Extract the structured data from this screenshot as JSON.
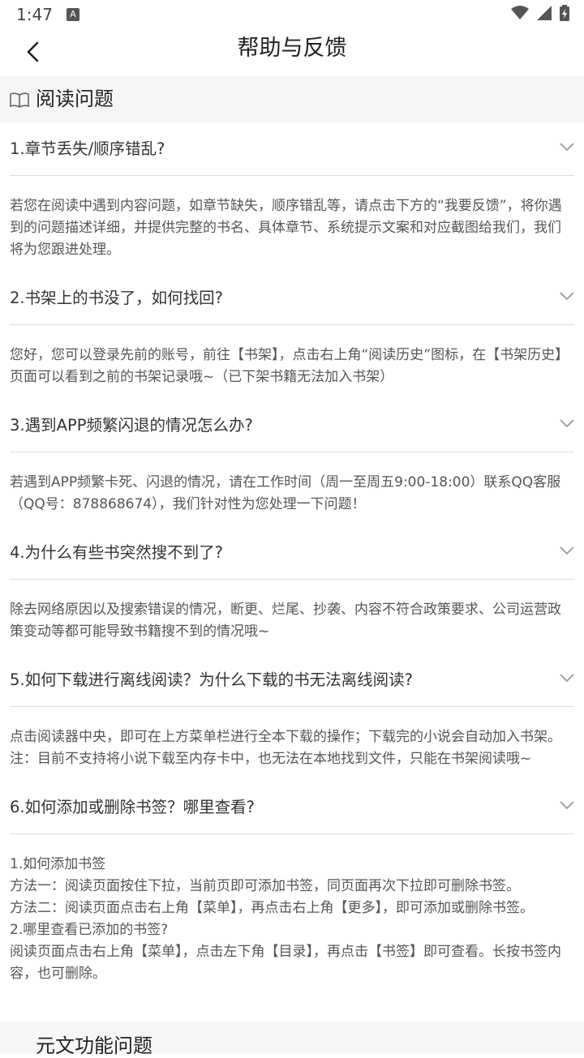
{
  "status": {
    "time": "1:47",
    "a_icon": "A"
  },
  "nav": {
    "title": "帮助与反馈"
  },
  "section": {
    "title": "阅读问题",
    "icon": "book-icon"
  },
  "faqs": [
    {
      "q": "1.章节丢失/顺序错乱?",
      "a": "若您在阅读中遇到内容问题，如章节缺失，顺序错乱等，请点击下方的“我要反馈”，将你遇到的问题描述详细，并提供完整的书名、具体章节、系统提示文案和对应截图给我们，我们将为您跟进处理。"
    },
    {
      "q": "2.书架上的书没了，如何找回?",
      "a": "您好，您可以登录先前的账号，前往【书架】，点击右上角“阅读历史”图标，在【书架历史】页面可以看到之前的书架记录哦~（已下架书籍无法加入书架）"
    },
    {
      "q": "3.遇到APP频繁闪退的情况怎么办?",
      "a": "若遇到APP频繁卡死、闪退的情况，请在工作时间（周一至周五9:00-18:00）联系QQ客服（QQ号：878868674），我们针对性为您处理一下问题！"
    },
    {
      "q": "4.为什么有些书突然搜不到了?",
      "a": "除去网络原因以及搜索错误的情况，断更、烂尾、抄袭、内容不符合政策要求、公司运营政策变动等都可能导致书籍搜不到的情况哦~"
    },
    {
      "q": "5.如何下载进行离线阅读？为什么下载的书无法离线阅读?",
      "a": "点击阅读器中央，即可在上方菜单栏进行全本下载的操作；下载完的小说会自动加入书架。\n注：目前不支持将小说下载至内存卡中，也无法在本地找到文件，只能在书架阅读哦~"
    },
    {
      "q": "6.如何添加或删除书签？哪里查看?",
      "a": "1.如何添加书签\n方法一：阅读页面按住下拉，当前页即可添加书签，同页面再次下拉即可删除书签。\n方法二：阅读页面点击右上角【菜单】，再点击右上角【更多】，即可添加或删除书签。\n2.哪里查看已添加的书签?\n阅读页面点击右上角【菜单】，点击左下角【目录】，再点击【书签】即可查看。长按书签内容，也可删除。"
    }
  ],
  "next_section": {
    "title": "元文功能问题"
  }
}
